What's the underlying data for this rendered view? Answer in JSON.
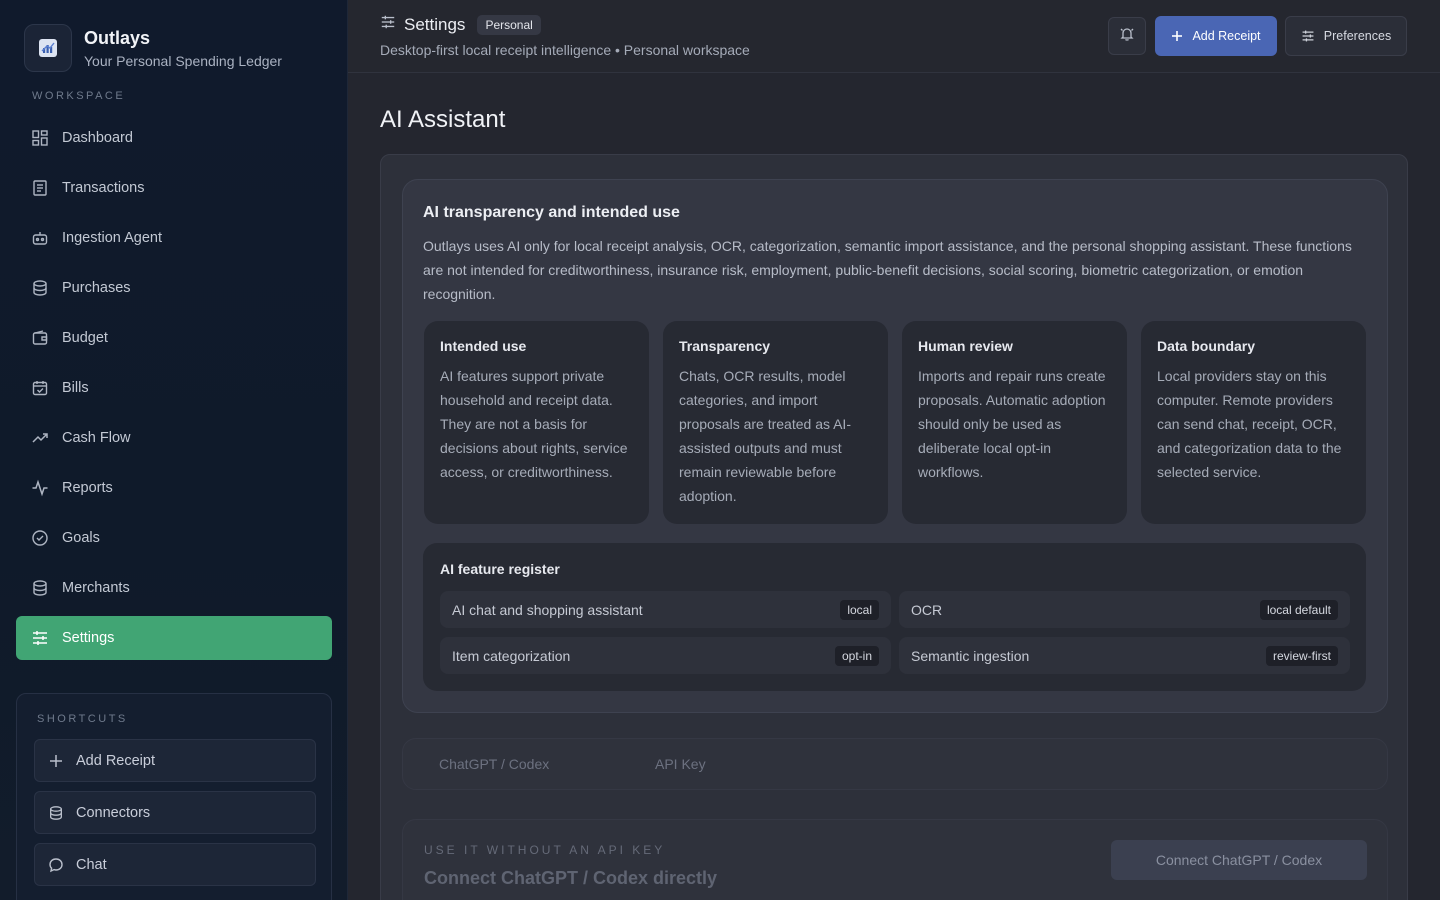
{
  "brand": {
    "title": "Outlays",
    "subtitle": "Your Personal Spending Ledger"
  },
  "sidebar": {
    "section_label": "WORKSPACE",
    "items": [
      {
        "label": "Dashboard",
        "icon": "dashboard-icon"
      },
      {
        "label": "Transactions",
        "icon": "document-icon"
      },
      {
        "label": "Ingestion Agent",
        "icon": "robot-icon"
      },
      {
        "label": "Purchases",
        "icon": "database-icon"
      },
      {
        "label": "Budget",
        "icon": "wallet-icon"
      },
      {
        "label": "Bills",
        "icon": "calendar-check-icon"
      },
      {
        "label": "Cash Flow",
        "icon": "trending-up-icon"
      },
      {
        "label": "Reports",
        "icon": "activity-icon"
      },
      {
        "label": "Goals",
        "icon": "check-circle-icon"
      },
      {
        "label": "Merchants",
        "icon": "database-icon"
      },
      {
        "label": "Settings",
        "icon": "sliders-icon",
        "active": true
      }
    ],
    "shortcuts_label": "SHORTCUTS",
    "shortcuts": [
      {
        "label": "Add Receipt",
        "icon": "plus-icon"
      },
      {
        "label": "Connectors",
        "icon": "database-icon"
      },
      {
        "label": "Chat",
        "icon": "chat-icon"
      }
    ]
  },
  "header": {
    "title": "Settings",
    "badge": "Personal",
    "subtitle": "Desktop-first local receipt intelligence • Personal workspace",
    "add_receipt": "Add Receipt",
    "preferences": "Preferences"
  },
  "main": {
    "page_title": "AI Assistant",
    "transparency": {
      "title": "AI transparency and intended use",
      "body": "Outlays uses AI only for local receipt analysis, OCR, categorization, semantic import assistance, and the personal shopping assistant. These functions are not intended for creditworthiness, insurance risk, employment, public-benefit decisions, social scoring, biometric categorization, or emotion recognition.",
      "tiles": [
        {
          "title": "Intended use",
          "body": "AI features support private household and receipt data. They are not a basis for decisions about rights, service access, or creditworthiness."
        },
        {
          "title": "Transparency",
          "body": "Chats, OCR results, model categories, and import proposals are treated as AI-assisted outputs and must remain reviewable before adoption."
        },
        {
          "title": "Human review",
          "body": "Imports and repair runs create proposals. Automatic adoption should only be used as deliberate local opt-in workflows."
        },
        {
          "title": "Data boundary",
          "body": "Local providers stay on this computer. Remote providers can send chat, receipt, OCR, and categorization data to the selected service."
        }
      ],
      "register": {
        "title": "AI feature register",
        "rows": [
          {
            "name": "AI chat and shopping assistant",
            "badge": "local"
          },
          {
            "name": "OCR",
            "badge": "local default"
          },
          {
            "name": "Item categorization",
            "badge": "opt-in"
          },
          {
            "name": "Semantic ingestion",
            "badge": "review-first"
          }
        ]
      }
    },
    "tabs": [
      "ChatGPT / Codex",
      "API Key"
    ],
    "no_api_key": {
      "label": "USE IT WITHOUT AN API KEY",
      "title": "Connect ChatGPT / Codex directly",
      "button": "Connect ChatGPT / Codex"
    }
  },
  "colors": {
    "accent_green": "#41a574",
    "primary_blue": "#4a66b4"
  }
}
